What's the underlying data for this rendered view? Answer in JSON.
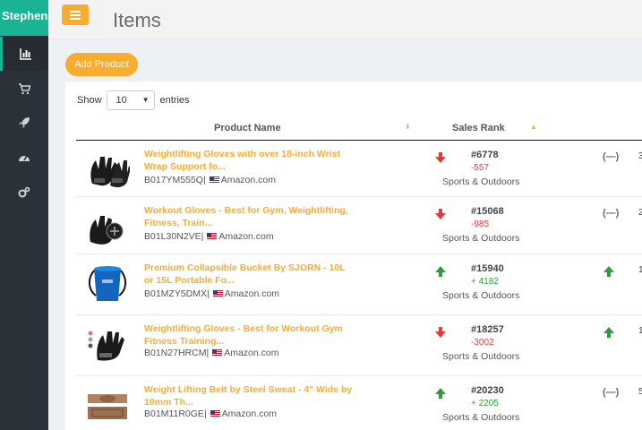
{
  "brand": "Stephen",
  "sidebar": {
    "items": [
      {
        "icon": "bar-chart-icon",
        "active": true
      },
      {
        "icon": "shopping-cart-icon",
        "active": false
      },
      {
        "icon": "rocket-icon",
        "active": false
      },
      {
        "icon": "dashboard-icon",
        "active": false
      },
      {
        "icon": "cogs-icon",
        "active": false
      }
    ]
  },
  "header": {
    "title": "Items"
  },
  "toolbar": {
    "add_label": "Add Product"
  },
  "table": {
    "show_label": "Show",
    "entries_value": "10",
    "entries_label": "entries",
    "columns": {
      "product": "Product Name",
      "sales_rank": "Sales Rank"
    },
    "rows": [
      {
        "name": "Weightlifting Gloves with over 18-inch Wrist Wrap Support fo...",
        "asin": "B017YM555Q",
        "store": "Amazon.com",
        "trend": "down",
        "rank": "#6778",
        "delta": "-557",
        "category": "Sports & Outdoors",
        "col3": "(—)",
        "edge": "3"
      },
      {
        "name": "Workout Gloves - Best for Gym, Weightlifting, Fitness, Train...",
        "asin": "B01L30N2VE",
        "store": "Amazon.com",
        "trend": "down",
        "rank": "#15068",
        "delta": "-985",
        "category": "Sports & Outdoors",
        "col3": "(—)",
        "edge": "2"
      },
      {
        "name": "Premium Collapsible Bucket By SJORN - 10L or 15L Portable Fo...",
        "asin": "B01MZY5DMX",
        "store": "Amazon.com",
        "trend": "up",
        "rank": "#15940",
        "delta": "+ 4182",
        "category": "Sports & Outdoors",
        "col3": "up",
        "edge": "1"
      },
      {
        "name": "Weightlifting Gloves - Best for Workout Gym Fitness Training...",
        "asin": "B01N27HRCM",
        "store": "Amazon.com",
        "trend": "down",
        "rank": "#18257",
        "delta": "-3002",
        "category": "Sports & Outdoors",
        "col3": "up",
        "edge": "1"
      },
      {
        "name": "Weight Lifting Belt by Steel Sweat - 4\" Wide by 10mm Th...",
        "asin": "B01M11R0GE",
        "store": "Amazon.com",
        "trend": "up",
        "rank": "#20230",
        "delta": "+ 2205",
        "category": "Sports & Outdoors",
        "col3": "(—)",
        "edge": "5"
      }
    ]
  },
  "colors": {
    "accent": "#f8ac30",
    "brand": "#1ab394",
    "sidebar": "#2a3139",
    "up": "#2e9e3a",
    "down": "#e53935"
  }
}
